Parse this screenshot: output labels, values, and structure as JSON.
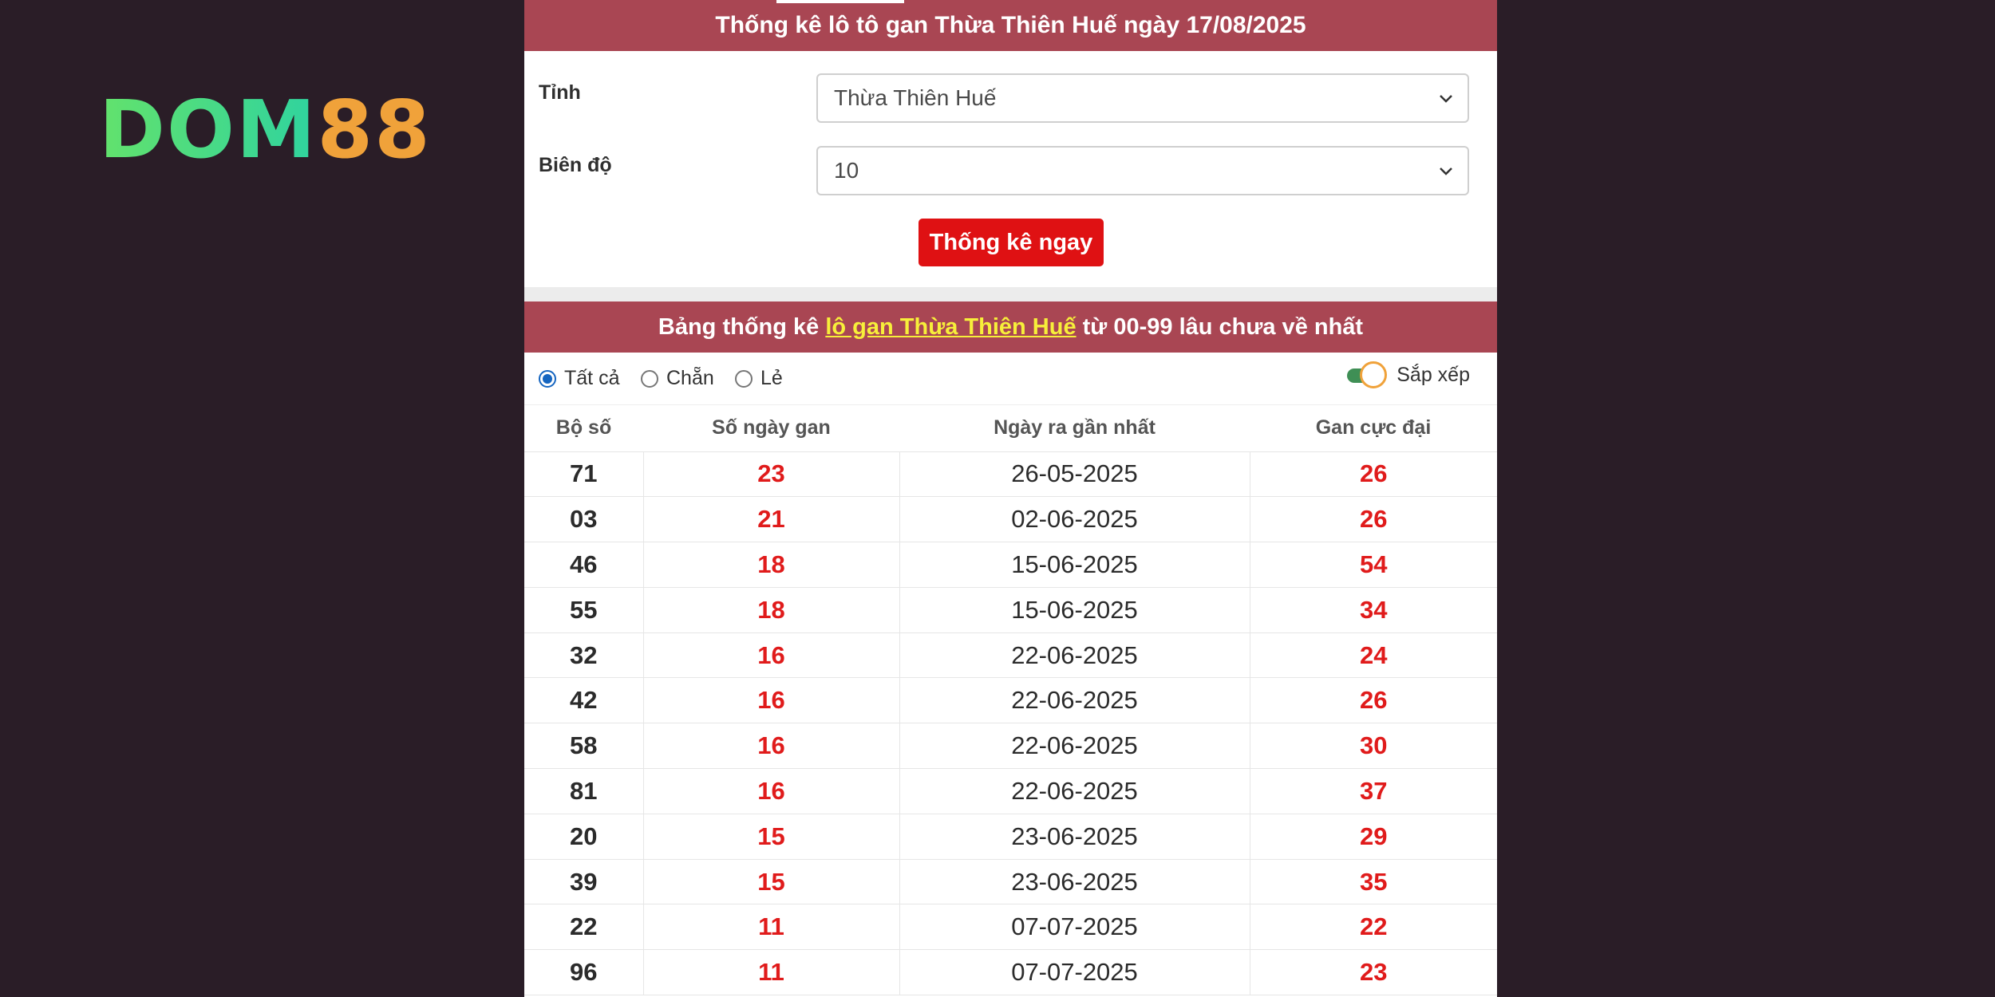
{
  "logo": {
    "part1": "DOM",
    "part2": "88"
  },
  "header": {
    "title": "Thống kê lô tô gan Thừa Thiên Huế ngày 17/08/2025"
  },
  "form": {
    "province_label": "Tỉnh",
    "province_value": "Thừa Thiên Huế",
    "range_label": "Biên độ",
    "range_value": "10",
    "submit_label": "Thống kê ngay"
  },
  "table_title": {
    "prefix": "Bảng thống kê ",
    "highlight": "lô gan Thừa Thiên Huế",
    "suffix": " từ 00-99 lâu chưa về nhất"
  },
  "filters": {
    "all_label": "Tất cả",
    "even_label": "Chẵn",
    "odd_label": "Lẻ",
    "sort_label": "Sắp xếp"
  },
  "columns": [
    "Bộ số",
    "Số ngày gan",
    "Ngày ra gần nhất",
    "Gan cực đại"
  ],
  "rows": [
    {
      "number": "71",
      "days": "23",
      "last_date": "26-05-2025",
      "max_gan": "26"
    },
    {
      "number": "03",
      "days": "21",
      "last_date": "02-06-2025",
      "max_gan": "26"
    },
    {
      "number": "46",
      "days": "18",
      "last_date": "15-06-2025",
      "max_gan": "54"
    },
    {
      "number": "55",
      "days": "18",
      "last_date": "15-06-2025",
      "max_gan": "34"
    },
    {
      "number": "32",
      "days": "16",
      "last_date": "22-06-2025",
      "max_gan": "24"
    },
    {
      "number": "42",
      "days": "16",
      "last_date": "22-06-2025",
      "max_gan": "26"
    },
    {
      "number": "58",
      "days": "16",
      "last_date": "22-06-2025",
      "max_gan": "30"
    },
    {
      "number": "81",
      "days": "16",
      "last_date": "22-06-2025",
      "max_gan": "37"
    },
    {
      "number": "20",
      "days": "15",
      "last_date": "23-06-2025",
      "max_gan": "29"
    },
    {
      "number": "39",
      "days": "15",
      "last_date": "23-06-2025",
      "max_gan": "35"
    },
    {
      "number": "22",
      "days": "11",
      "last_date": "07-07-2025",
      "max_gan": "22"
    },
    {
      "number": "96",
      "days": "11",
      "last_date": "07-07-2025",
      "max_gan": "23"
    }
  ]
}
